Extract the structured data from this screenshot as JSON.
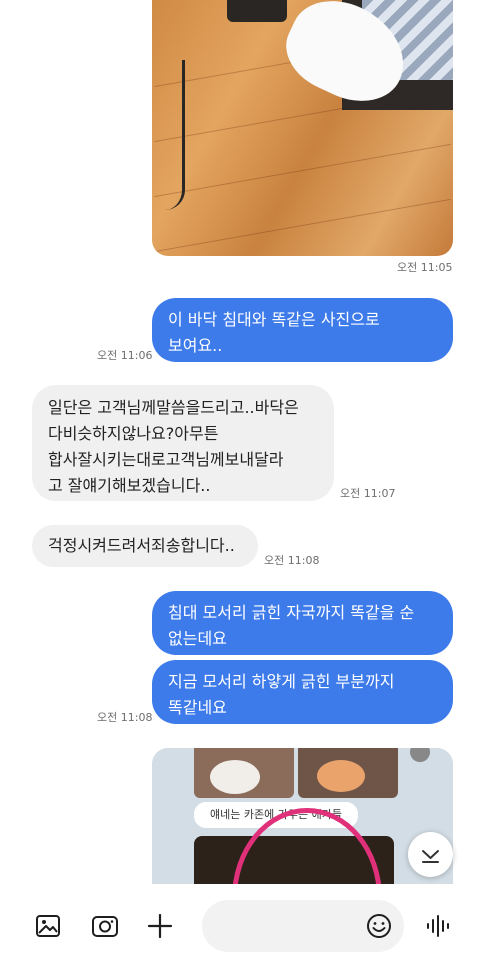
{
  "messages": [
    {
      "text": "이 바닥 침대와 똑같은 사진으로\n보여요..",
      "time": "오전 11:06"
    },
    {
      "text": "일단은 고객님께말씀을드리고..바닥은\n다비슷하지않나요?아무튼\n합사잘시키는대로고객님께보내달라\n고 잘얘기해보겠습니다..",
      "time": "오전 11:07"
    },
    {
      "text": "걱정시켜드려서죄송합니다..",
      "time": "오전 11:08"
    },
    {
      "text": "침대 모서리 긁힌 자국까지 똑같을 순\n없는데요"
    },
    {
      "text": "지금 모서리 하얗게 긁힌 부분까지\n똑같네요",
      "time": "오전 11:08"
    }
  ],
  "top_photo_time": "오전 11:05",
  "photo_caption": "얘네는 카존에 가두는 애가들",
  "icons": [
    "gallery-icon",
    "camera-icon",
    "plus-icon",
    "emoji-icon",
    "voice-icon",
    "scroll-down-icon"
  ]
}
